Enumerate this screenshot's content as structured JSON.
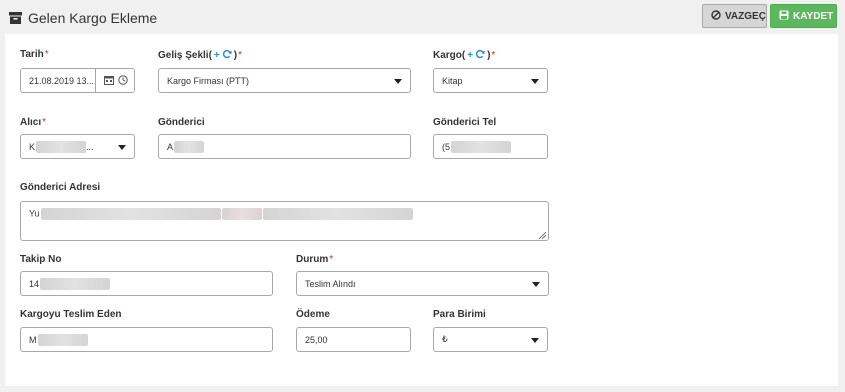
{
  "header": {
    "title": "Gelen Kargo Ekleme",
    "cancel_label": "VAZGEÇ",
    "save_label": "KAYDET"
  },
  "form": {
    "tarih": {
      "label": "Tarih",
      "value": "21.08.2019 13...."
    },
    "gelis_sekli": {
      "label": "Geliş Şekli(",
      "label_end": ")",
      "value": "Kargo Firması (PTT)"
    },
    "kargo": {
      "label": "Kargo(",
      "label_end": ")",
      "value": "Kitap"
    },
    "alici": {
      "label": "Alıcı",
      "value_prefix": "K",
      "value_suffix": "..."
    },
    "gonderici": {
      "label": "Gönderici",
      "value_prefix": "A"
    },
    "gonderici_tel": {
      "label": "Gönderici Tel",
      "value_prefix": "(5"
    },
    "gonderici_adresi": {
      "label": "Gönderici Adresi",
      "value_prefix": "Yu"
    },
    "takip_no": {
      "label": "Takip No",
      "value_prefix": "14"
    },
    "durum": {
      "label": "Durum",
      "value": "Teslim Alındı"
    },
    "kargoyu_teslim_eden": {
      "label": "Kargoyu Teslim Eden",
      "value_prefix": "M"
    },
    "odeme": {
      "label": "Ödeme",
      "value": "25,00"
    },
    "para_birimi": {
      "label": "Para Birimi",
      "value": "₺"
    }
  },
  "required_mark": "*",
  "plus_glyph": "+",
  "colors": {
    "save": "#5cb85c",
    "cancel": "#d6d6d6",
    "required": "#c9302c",
    "action_icon": "#2a8bd8"
  },
  "icons": [
    "archive-icon",
    "ban-icon",
    "floppy-icon",
    "calendar-icon",
    "clock-icon",
    "plus-icon",
    "refresh-icon",
    "chevron-down-icon"
  ]
}
